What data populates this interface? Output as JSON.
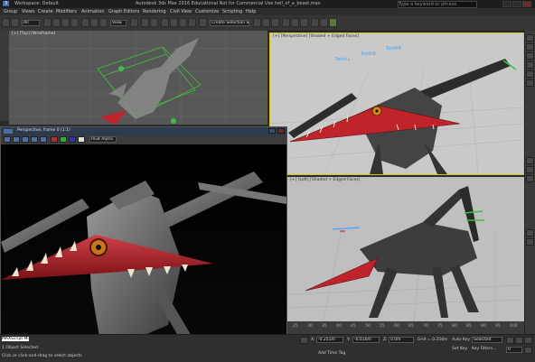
{
  "window": {
    "workspace": "Workspace: Default",
    "title": "Autodesk 3ds Max 2016 Educational  Not for Commercial Use  hell_of_a_beast.max",
    "search_placeholder": "Type a keyword or phrase"
  },
  "menu": [
    "Group",
    "Views",
    "Create",
    "Modifiers",
    "Animation",
    "Graph Editors",
    "Rendering",
    "Civil View",
    "Customize",
    "Scripting",
    "Help"
  ],
  "toolbar": {
    "selection_filter": "All",
    "coord_system": "View",
    "named_selection": "Create Selection Se"
  },
  "viewports": {
    "top": "[+] [Top] [Wireframe]",
    "persp1": "[+] [Perspective] [Shaded + Edged Faces]",
    "persp2": "[+] [Left] [Shaded + Edged Faces]"
  },
  "labels3d": [
    "ToothL",
    "ToothB",
    "ToothR"
  ],
  "render_window": {
    "title": "Perspective, frame 0 (1:1)",
    "area_option": "Region",
    "channel": "RGB Alpha"
  },
  "trackbar": {
    "ticks": [
      "25",
      "30",
      "35",
      "40",
      "45",
      "50",
      "55",
      "60",
      "65",
      "70",
      "75",
      "80",
      "85",
      "90",
      "95",
      "100"
    ]
  },
  "status": {
    "maxscript": "MAXScript Mi",
    "selected": "1 Object Selected",
    "hint": "Click or click-and-drag to select objects",
    "x_label": "X:",
    "x_value": "-0.251m",
    "y_label": "Y:",
    "y_value": "-0.016m",
    "z_label": "Z:",
    "z_value": "0.0m",
    "grid": "Grid = 0.254m",
    "autokey": "Auto Key",
    "autokey_mode": "Selected",
    "setkey": "Set Key",
    "keyfilters": "Key Filters...",
    "add_time_tag": "Add Time Tag",
    "frame": "0"
  },
  "colors": {
    "accent_yellow": "#d8c020",
    "monster_red": "#c0242b",
    "timeline_blue": "#3a6ea5"
  }
}
